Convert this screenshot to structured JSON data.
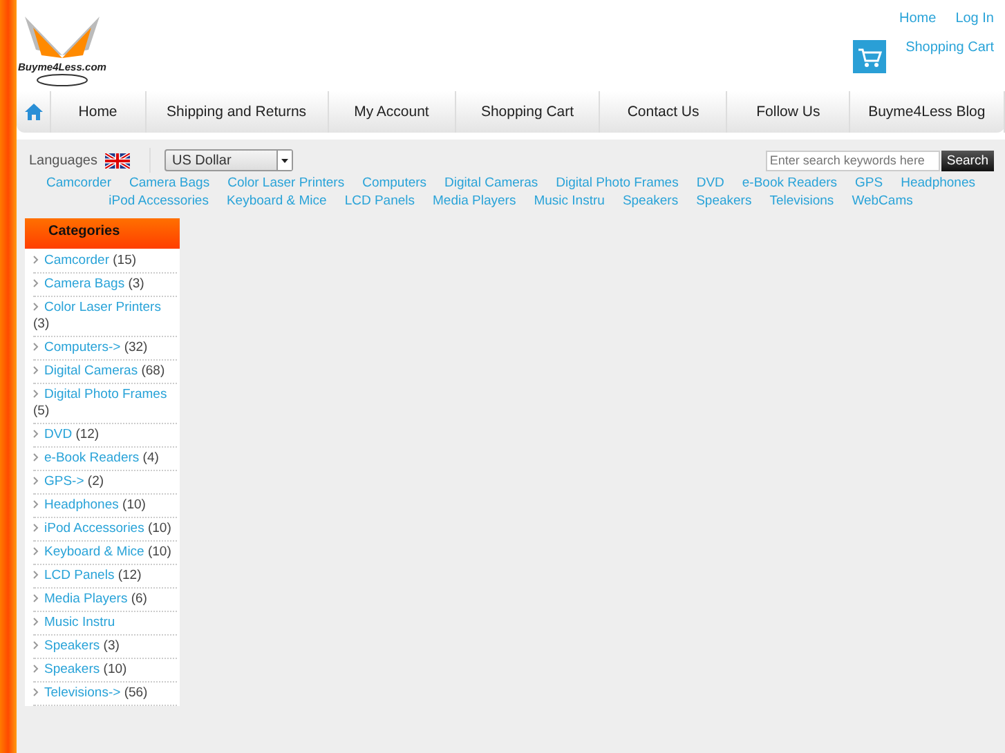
{
  "header": {
    "logo_text": "Buyme4Less.com",
    "top_links": [
      "Home",
      "Log In"
    ],
    "cart_link": "Shopping Cart"
  },
  "nav": {
    "items": [
      {
        "label": "Home"
      },
      {
        "label": "Shipping and Returns"
      },
      {
        "label": "My Account"
      },
      {
        "label": "Shopping Cart"
      },
      {
        "label": "Contact Us"
      },
      {
        "label": "Follow Us"
      },
      {
        "label": "Buyme4Less Blog"
      }
    ]
  },
  "toolbar": {
    "languages_label": "Languages",
    "currency": "US Dollar",
    "search": {
      "placeholder": "Enter search keywords here"
    },
    "search_button": "Search"
  },
  "category_links": [
    "Camcorder",
    "Camera Bags",
    "Color Laser Printers",
    "Computers",
    "Digital Cameras",
    "Digital Photo Frames",
    "DVD",
    "e-Book Readers",
    "GPS",
    "Headphones",
    "iPod Accessories",
    "Keyboard & Mice",
    "LCD Panels",
    "Media Players",
    "Music Instru",
    "Speakers",
    "Speakers",
    "Televisions",
    "WebCams"
  ],
  "sidebar": {
    "title": "Categories",
    "items": [
      {
        "name": "Camcorder",
        "count": "(15)"
      },
      {
        "name": "Camera Bags",
        "count": "(3)"
      },
      {
        "name": "Color Laser Printers",
        "count": "(3)"
      },
      {
        "name": "Computers->",
        "count": "(32)"
      },
      {
        "name": "Digital Cameras",
        "count": "(68)"
      },
      {
        "name": "Digital Photo Frames",
        "count": "(5)"
      },
      {
        "name": "DVD",
        "count": "(12)"
      },
      {
        "name": "e-Book Readers",
        "count": "(4)"
      },
      {
        "name": "GPS->",
        "count": "(2)"
      },
      {
        "name": "Headphones",
        "count": "(10)"
      },
      {
        "name": "iPod Accessories",
        "count": "(10)"
      },
      {
        "name": "Keyboard & Mice",
        "count": "(10)"
      },
      {
        "name": "LCD Panels",
        "count": "(12)"
      },
      {
        "name": "Media Players",
        "count": "(6)"
      },
      {
        "name": "Music Instru"
      },
      {
        "name": "Speakers",
        "count": "(3)"
      },
      {
        "name": "Speakers",
        "count": "(10)"
      },
      {
        "name": "Televisions->",
        "count": "(56)"
      }
    ]
  }
}
